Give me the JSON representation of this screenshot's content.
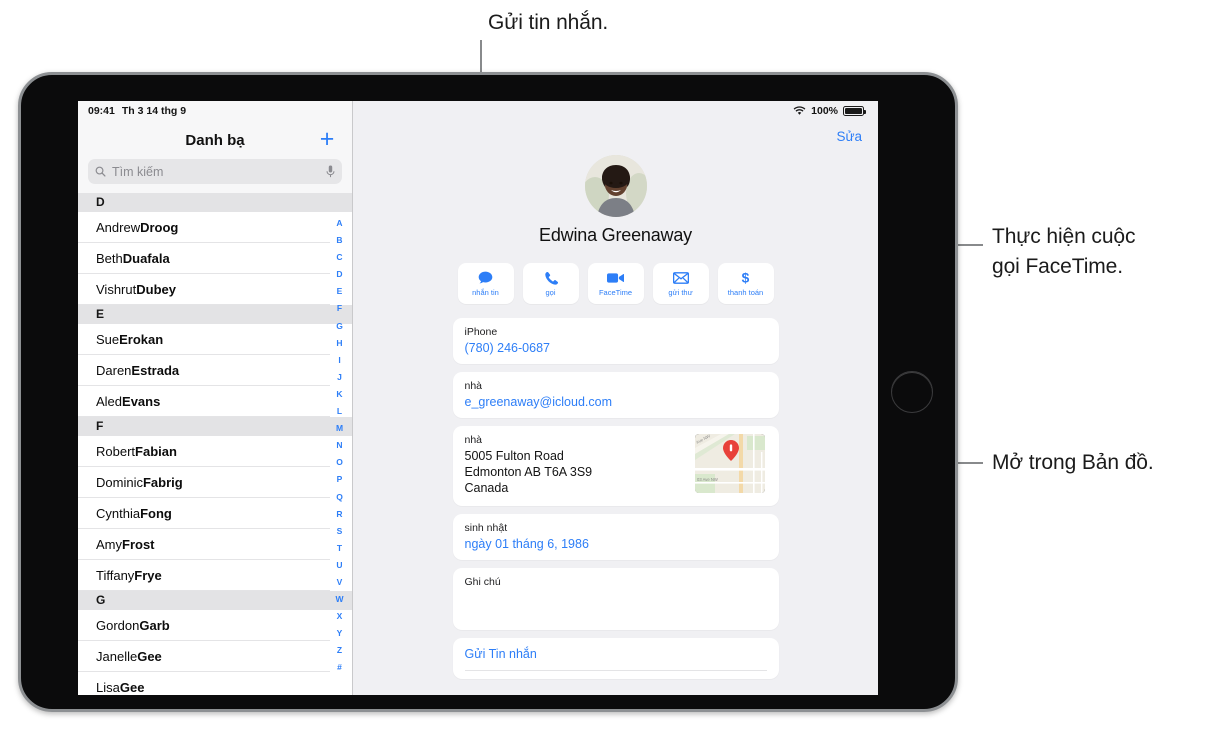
{
  "callouts": [
    {
      "id": "message",
      "text": "Gửi tin nhắn."
    },
    {
      "id": "facetime",
      "text": "Thực hiện cuộc\ngọi FaceTime."
    },
    {
      "id": "maps",
      "text": "Mở trong Bản đồ."
    }
  ],
  "status_bar": {
    "time": "09:41",
    "date": "Th 3 14 thg 9",
    "wifi_icon": "wifi-icon",
    "battery_percent": "100%",
    "battery_icon": "battery-full-icon"
  },
  "sidebar": {
    "title": "Danh bạ",
    "add_icon": "plus-icon",
    "search": {
      "placeholder": "Tìm kiếm",
      "search_icon": "search-icon",
      "mic_icon": "microphone-icon"
    },
    "sections": [
      {
        "letter": "D",
        "contacts": [
          {
            "first": "Andrew ",
            "last": "Droog"
          },
          {
            "first": "Beth ",
            "last": "Duafala"
          },
          {
            "first": "Vishrut ",
            "last": "Dubey"
          }
        ]
      },
      {
        "letter": "E",
        "contacts": [
          {
            "first": "Sue ",
            "last": "Erokan"
          },
          {
            "first": "Daren ",
            "last": "Estrada"
          },
          {
            "first": "Aled ",
            "last": "Evans"
          }
        ]
      },
      {
        "letter": "F",
        "contacts": [
          {
            "first": "Robert ",
            "last": "Fabian"
          },
          {
            "first": "Dominic ",
            "last": "Fabrig"
          },
          {
            "first": "Cynthia ",
            "last": "Fong"
          },
          {
            "first": "Amy ",
            "last": "Frost"
          },
          {
            "first": "Tiffany ",
            "last": "Frye"
          }
        ]
      },
      {
        "letter": "G",
        "contacts": [
          {
            "first": "Gordon ",
            "last": "Garb"
          },
          {
            "first": "Janelle ",
            "last": "Gee"
          },
          {
            "first": "Lisa ",
            "last": "Gee"
          }
        ]
      }
    ],
    "index": [
      "A",
      "B",
      "C",
      "D",
      "E",
      "F",
      "G",
      "H",
      "I",
      "J",
      "K",
      "L",
      "M",
      "N",
      "O",
      "P",
      "Q",
      "R",
      "S",
      "T",
      "U",
      "V",
      "W",
      "X",
      "Y",
      "Z",
      "#"
    ]
  },
  "detail": {
    "edit_label": "Sửa",
    "avatar_icon": "contact-photo",
    "contact_name": "Edwina Greenaway",
    "actions": [
      {
        "label": "nhắn tin",
        "icon": "message-bubble-icon"
      },
      {
        "label": "gọi",
        "icon": "phone-icon"
      },
      {
        "label": "FaceTime",
        "icon": "video-camera-icon"
      },
      {
        "label": "gửi thư",
        "icon": "envelope-icon"
      },
      {
        "label": "thanh toán",
        "icon": "dollar-sign-icon"
      }
    ],
    "fields": [
      {
        "label": "iPhone",
        "value": "(780) 246-0687"
      },
      {
        "label": "nhà",
        "value": "e_greenaway@icloud.com"
      }
    ],
    "address": {
      "label": "nhà",
      "line1": "5005 Fulton Road",
      "line2": "Edmonton AB T6A 3S9",
      "line3": "Canada",
      "map_icon": "map-thumbnail",
      "map_pin_icon": "map-pin-icon",
      "map_street_top": "Ave NW",
      "map_street_bottom": "03 Ave NW"
    },
    "birthday": {
      "label": "sinh nhật",
      "value": "ngày 01 tháng 6, 1986"
    },
    "notes": {
      "label": "Ghi chú",
      "value": ""
    },
    "send_message": {
      "label": "Gửi Tin nhắn"
    }
  },
  "colors": {
    "accent": "#2d7ef7",
    "screen_bg": "#f0f0f3",
    "pin_red": "#e8413a"
  }
}
